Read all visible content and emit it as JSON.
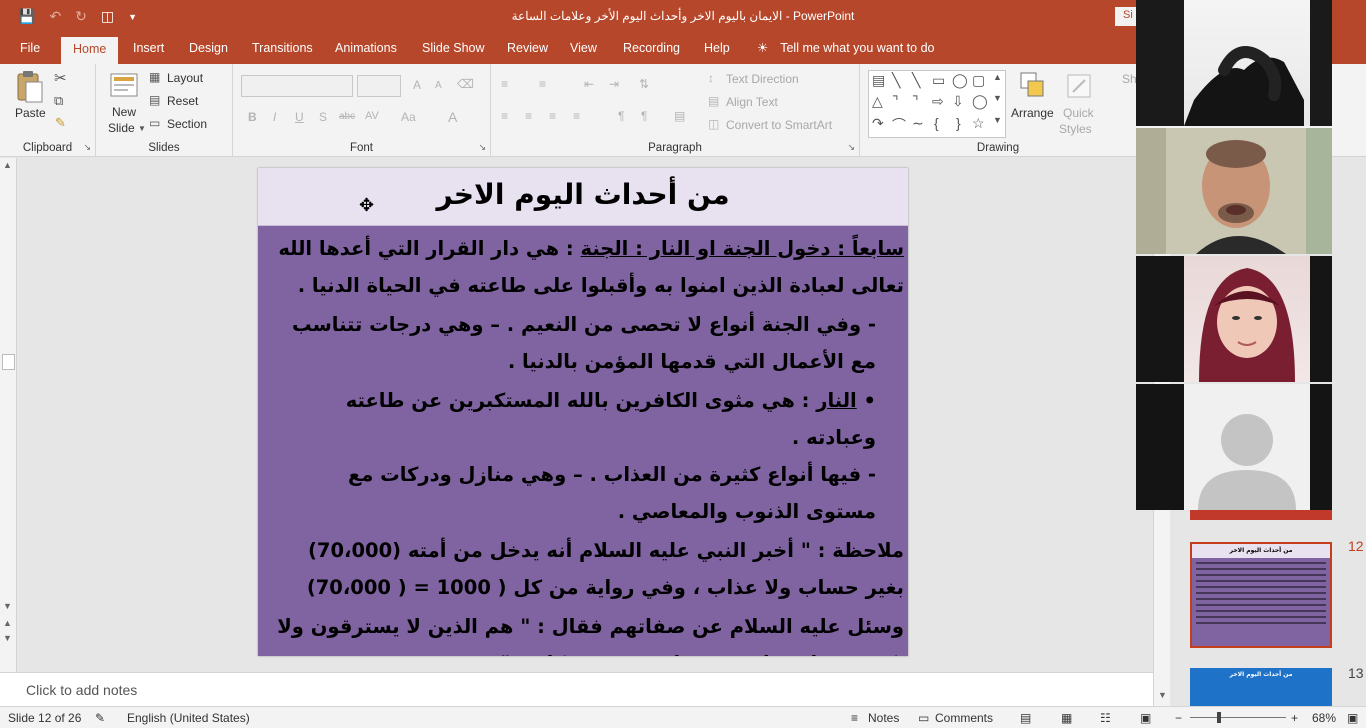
{
  "titlebar": {
    "document_title": "الايمان باليوم الاخر وأحداث اليوم الأخر وعلامات الساعة  -  PowerPoint",
    "signin_label": "Si"
  },
  "tabs": [
    {
      "label": "File"
    },
    {
      "label": "Home"
    },
    {
      "label": "Insert"
    },
    {
      "label": "Design"
    },
    {
      "label": "Transitions"
    },
    {
      "label": "Animations"
    },
    {
      "label": "Slide Show"
    },
    {
      "label": "Review"
    },
    {
      "label": "View"
    },
    {
      "label": "Recording"
    },
    {
      "label": "Help"
    }
  ],
  "tell_me": "Tell me what you want to do",
  "ribbon": {
    "clipboard": {
      "paste": "Paste",
      "label": "Clipboard"
    },
    "slides": {
      "new_slide_line1": "New",
      "new_slide_line2": "Slide",
      "layout": "Layout",
      "reset": "Reset",
      "section": "Section",
      "label": "Slides"
    },
    "font": {
      "label": "Font",
      "bold": "B",
      "italic": "I",
      "underline": "U",
      "shadow": "S",
      "strike": "abc",
      "spacing": "AV",
      "case": "Aa",
      "color": "A",
      "grow": "A",
      "shrink": "A"
    },
    "paragraph": {
      "label": "Paragraph",
      "text_direction": "Text Direction",
      "align_text": "Align Text",
      "convert_smartart": "Convert to SmartArt"
    },
    "drawing": {
      "label": "Drawing",
      "arrange": "Arrange",
      "quick_line1": "Quick",
      "quick_line2": "Styles",
      "shape_fill": "Sh"
    }
  },
  "slide": {
    "title": "من أحداث اليوم الاخر",
    "p1_a": "سابعاً : دخول الجنة او النار : ",
    "p1_b": "الجنة",
    "p1_c": " : هي دار القرار التي أعدها الله تعالى لعبادة الذين امنوا به وأقبلوا على طاعته في الحياة الدنيا .",
    "p2": "-  وفي الجنة أنواع لا تحصى من النعيم . – وهي درجات تتناسب مع الأعمال التي قدمها المؤمن بالدنيا .",
    "p3_a": "•  ",
    "p3_b": "النار",
    "p3_c": " : هي مثوى الكافرين بالله المستكبرين عن طاعته وعبادته .",
    "p4": "-  فيها أنواع كثيرة من العذاب . – وهي منازل ودركات مع مستوى الذنوب والمعاصي .",
    "p5": "ملاحظة : \" أخبر النبي عليه السلام أنه يدخل من أمته (70،000) بغير حساب ولا عذاب ، وفي رواية من كل ( 1000 = ( 70،000)",
    "p6": "وسئل عليه السلام عن صفاتهم فقال : \" هم الذين لا يسترقون ولا يكتوون ولا يتطيرون وعلى ربهم يتوكلون \""
  },
  "notes_placeholder": "Click to add notes",
  "thumbnails": [
    {
      "number": "12",
      "title": "من أحداث اليوم الاخر"
    },
    {
      "number": "13",
      "title": "من أحداث اليوم الاخر"
    }
  ],
  "statusbar": {
    "slide_count": "Slide 12 of 26",
    "language": "English (United States)",
    "notes": "Notes",
    "comments": "Comments",
    "zoom_minus": "−",
    "zoom_plus": "+",
    "zoom": "68%"
  },
  "colors": {
    "accent": "#b7472a",
    "slide_bg": "#8064a2",
    "slide_header": "#e8e1f0",
    "thumb13_bg": "#1e73c8"
  },
  "video_tiles": [
    {
      "icon": "hand-gesture-video"
    },
    {
      "icon": "man-speaking-video"
    },
    {
      "icon": "woman-hijab-video"
    },
    {
      "icon": "avatar-placeholder-icon"
    }
  ]
}
